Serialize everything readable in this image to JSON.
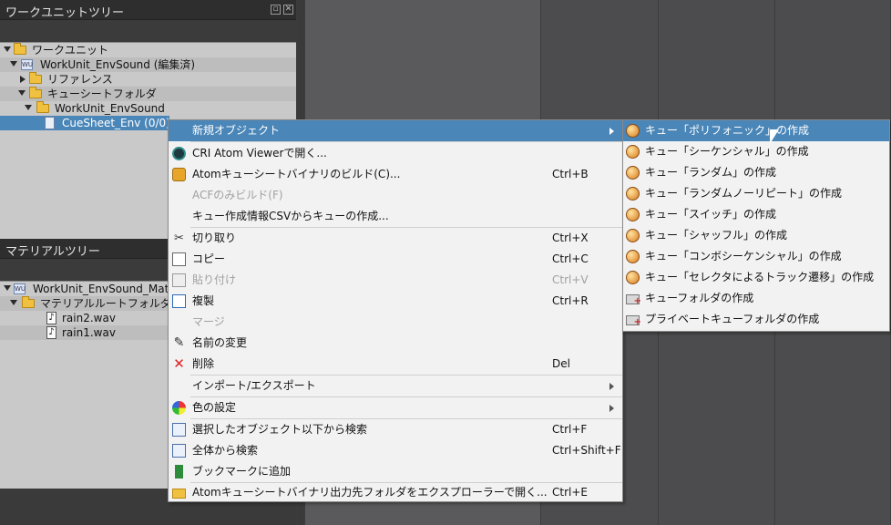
{
  "workunit_panel": {
    "title": "ワークユニットツリー",
    "tree": [
      {
        "label": "ワークユニット",
        "icon": "folder-open-icon"
      },
      {
        "label": "WorkUnit_EnvSound (編集済)",
        "icon": "workunit-icon"
      },
      {
        "label": "リファレンス",
        "icon": "folder-icon"
      },
      {
        "label": "キューシートフォルダ",
        "icon": "folder-open-icon"
      },
      {
        "label": "WorkUnit_EnvSound",
        "icon": "folder-open-icon"
      },
      {
        "label": "CueSheet_Env (0/0)",
        "icon": "cuesheet-icon"
      }
    ]
  },
  "material_panel": {
    "title": "マテリアルツリー",
    "tree": [
      {
        "label": "WorkUnit_EnvSound_Materi",
        "icon": "material-workunit-icon"
      },
      {
        "label": "マテリアルルートフォルダ",
        "icon": "folder-open-icon"
      },
      {
        "label": "rain2.wav",
        "icon": "wav-file-icon"
      },
      {
        "label": "rain1.wav",
        "icon": "wav-file-icon"
      }
    ]
  },
  "context_menu": {
    "items": [
      {
        "label": "新規オブジェクト",
        "shortcut": "",
        "icon": "",
        "submenu": true,
        "disabled": false
      },
      {
        "label": "CRI Atom Viewerで開く...",
        "shortcut": "",
        "icon": "atom-viewer-icon",
        "disabled": false
      },
      {
        "label": "Atomキューシートバイナリのビルド(C)...",
        "shortcut": "Ctrl+B",
        "icon": "build-icon",
        "disabled": false
      },
      {
        "label": "ACFのみビルド(F)",
        "shortcut": "",
        "icon": "",
        "disabled": true
      },
      {
        "label": "キュー作成情報CSVからキューの作成...",
        "shortcut": "",
        "icon": "",
        "disabled": false
      },
      {
        "label": "切り取り",
        "shortcut": "Ctrl+X",
        "icon": "scissors-icon",
        "disabled": false
      },
      {
        "label": "コピー",
        "shortcut": "Ctrl+C",
        "icon": "copy-icon",
        "disabled": false
      },
      {
        "label": "貼り付け",
        "shortcut": "Ctrl+V",
        "icon": "paste-icon",
        "disabled": true
      },
      {
        "label": "複製",
        "shortcut": "Ctrl+R",
        "icon": "duplicate-icon",
        "disabled": false
      },
      {
        "label": "マージ",
        "shortcut": "",
        "icon": "",
        "disabled": true
      },
      {
        "label": "名前の変更",
        "shortcut": "",
        "icon": "pencil-icon",
        "disabled": false
      },
      {
        "label": "削除",
        "shortcut": "Del",
        "icon": "delete-x-icon",
        "disabled": false
      },
      {
        "label": "インポート/エクスポート",
        "shortcut": "",
        "icon": "",
        "submenu": true,
        "disabled": false
      },
      {
        "label": "色の設定",
        "shortcut": "",
        "icon": "color-wheel-icon",
        "submenu": true,
        "disabled": false
      },
      {
        "label": "選択したオブジェクト以下から検索",
        "shortcut": "Ctrl+F",
        "icon": "search-icon",
        "disabled": false
      },
      {
        "label": "全体から検索",
        "shortcut": "Ctrl+Shift+F",
        "icon": "search-icon",
        "disabled": false
      },
      {
        "label": "ブックマークに追加",
        "shortcut": "",
        "icon": "bookmark-icon",
        "disabled": false
      },
      {
        "label": "Atomキューシートバイナリ出力先フォルダをエクスプローラーで開く...",
        "shortcut": "Ctrl+E",
        "icon": "folder-icon",
        "disabled": false
      }
    ]
  },
  "submenu": {
    "items": [
      {
        "label": "キュー「ポリフォニック」の作成",
        "icon": "cue-icon"
      },
      {
        "label": "キュー「シーケンシャル」の作成",
        "icon": "cue-icon"
      },
      {
        "label": "キュー「ランダム」の作成",
        "icon": "cue-icon"
      },
      {
        "label": "キュー「ランダムノーリピート」の作成",
        "icon": "cue-icon"
      },
      {
        "label": "キュー「スイッチ」の作成",
        "icon": "cue-icon"
      },
      {
        "label": "キュー「シャッフル」の作成",
        "icon": "cue-icon"
      },
      {
        "label": "キュー「コンボシーケンシャル」の作成",
        "icon": "cue-icon"
      },
      {
        "label": "キュー「セレクタによるトラック遷移」の作成",
        "icon": "cue-icon"
      },
      {
        "label": "キューフォルダの作成",
        "icon": "cue-folder-icon"
      },
      {
        "label": "プライベートキューフォルダの作成",
        "icon": "cue-folder-icon"
      }
    ]
  },
  "colors": {
    "highlight": "#4a86b8",
    "panel_bg": "#c9c9c9",
    "menu_bg": "#f2f2f2"
  }
}
